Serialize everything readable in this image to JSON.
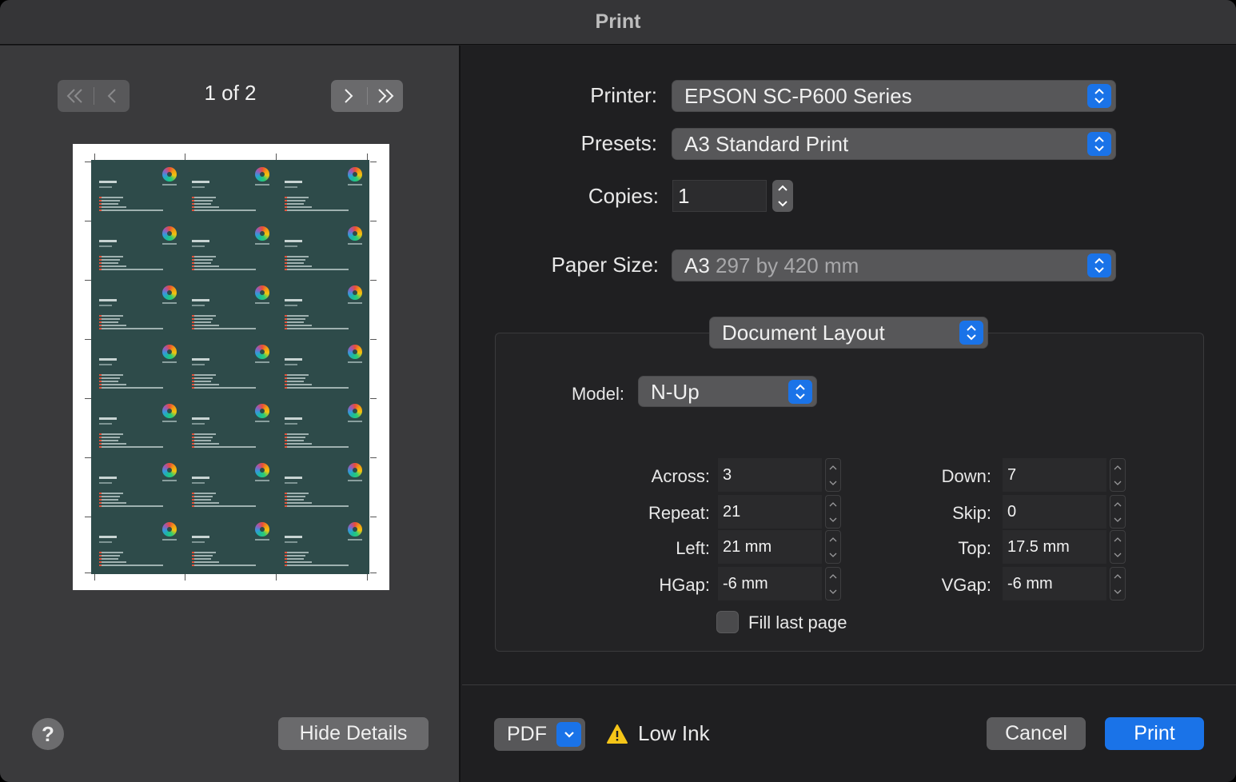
{
  "window": {
    "title": "Print"
  },
  "preview": {
    "page_indicator": "1 of 2",
    "help_label": "?",
    "hide_details_label": "Hide Details"
  },
  "form": {
    "printer_label": "Printer:",
    "printer_value": "EPSON SC-P600 Series",
    "presets_label": "Presets:",
    "presets_value": "A3 Standard Print",
    "copies_label": "Copies:",
    "copies_value": "1",
    "paper_size_label": "Paper Size:",
    "paper_size_name": "A3",
    "paper_size_dims": "297 by 420 mm",
    "section_popup": "Document Layout"
  },
  "layout": {
    "model_label": "Model:",
    "model_value": "N-Up",
    "across_label": "Across:",
    "across_value": "3",
    "down_label": "Down:",
    "down_value": "7",
    "repeat_label": "Repeat:",
    "repeat_value": "21",
    "skip_label": "Skip:",
    "skip_value": "0",
    "left_label": "Left:",
    "left_value": "21 mm",
    "top_label": "Top:",
    "top_value": "17.5 mm",
    "hgap_label": "HGap:",
    "hgap_value": "-6 mm",
    "vgap_label": "VGap:",
    "vgap_value": "-6 mm",
    "fill_last_page_label": "Fill last page",
    "fill_last_page_checked": false
  },
  "footer": {
    "pdf_label": "PDF",
    "warning_text": "Low Ink",
    "cancel_label": "Cancel",
    "print_label": "Print"
  },
  "colors": {
    "accent": "#1a73e8",
    "window_bg": "#1f1f21",
    "sidebar_bg": "#3a3a3c",
    "card_bg": "#2e4b4a",
    "warning": "#f5c518"
  }
}
